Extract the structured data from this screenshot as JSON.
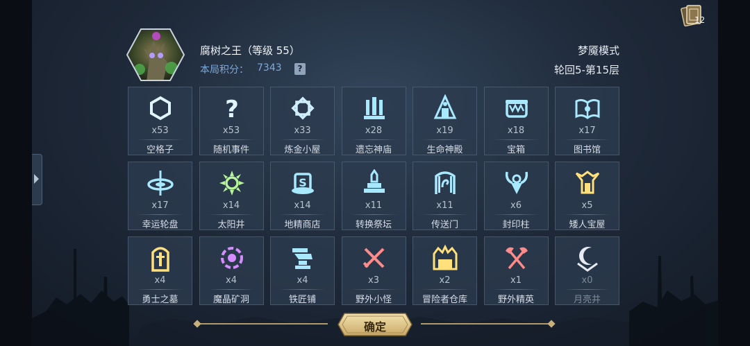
{
  "header": {
    "boss_title": "腐树之王（等级 55）",
    "score_label": "本局积分：",
    "score_value": "7343",
    "help": "?",
    "mode": "梦魇模式",
    "round": "轮回5-第15层"
  },
  "deck": {
    "count": "12"
  },
  "cells": [
    {
      "count": "x53",
      "name": "空格子",
      "icon": "hexagon-icon",
      "color": "#dff6ff"
    },
    {
      "count": "x53",
      "name": "随机事件",
      "icon": "question-icon",
      "color": "#dff6ff"
    },
    {
      "count": "x33",
      "name": "炼金小屋",
      "icon": "alchemy-icon",
      "color": "#cfeeff"
    },
    {
      "count": "x28",
      "name": "遗忘神庙",
      "icon": "temple-icon",
      "color": "#a9e9ff"
    },
    {
      "count": "x19",
      "name": "生命神殿",
      "icon": "life-shrine-icon",
      "color": "#a9e9ff"
    },
    {
      "count": "x18",
      "name": "宝箱",
      "icon": "chest-icon",
      "color": "#a9e9ff"
    },
    {
      "count": "x17",
      "name": "图书馆",
      "icon": "library-icon",
      "color": "#a9e9ff"
    },
    {
      "count": "x17",
      "name": "幸运轮盘",
      "icon": "roulette-icon",
      "color": "#a9e9ff"
    },
    {
      "count": "x14",
      "name": "太阳井",
      "icon": "sun-well-icon",
      "color": "#b6f59a"
    },
    {
      "count": "x14",
      "name": "地精商店",
      "icon": "goblin-shop-icon",
      "color": "#a9e9ff"
    },
    {
      "count": "x11",
      "name": "转换祭坛",
      "icon": "altar-icon",
      "color": "#a9e9ff"
    },
    {
      "count": "x11",
      "name": "传送门",
      "icon": "portal-icon",
      "color": "#a9e9ff"
    },
    {
      "count": "x6",
      "name": "封印柱",
      "icon": "seal-pillar-icon",
      "color": "#a9e9ff"
    },
    {
      "count": "x5",
      "name": "矮人宝屋",
      "icon": "dwarf-vault-icon",
      "color": "#ffe07a"
    },
    {
      "count": "x4",
      "name": "勇士之墓",
      "icon": "tomb-icon",
      "color": "#ffe07a"
    },
    {
      "count": "x4",
      "name": "魔晶矿洞",
      "icon": "crystal-mine-icon",
      "color": "#d58cff"
    },
    {
      "count": "x4",
      "name": "铁匠铺",
      "icon": "anvil-icon",
      "color": "#a9e9ff"
    },
    {
      "count": "x3",
      "name": "野外小怪",
      "icon": "crossed-swords-icon",
      "color": "#ff8a8a"
    },
    {
      "count": "x2",
      "name": "冒险者仓库",
      "icon": "warehouse-icon",
      "color": "#ffe07a"
    },
    {
      "count": "x1",
      "name": "野外精英",
      "icon": "crossed-axes-icon",
      "color": "#ff8a8a"
    },
    {
      "count": "x0",
      "name": "月亮井",
      "icon": "moon-well-icon",
      "color": "#e6ebf2"
    }
  ],
  "confirm": {
    "label": "确定"
  }
}
